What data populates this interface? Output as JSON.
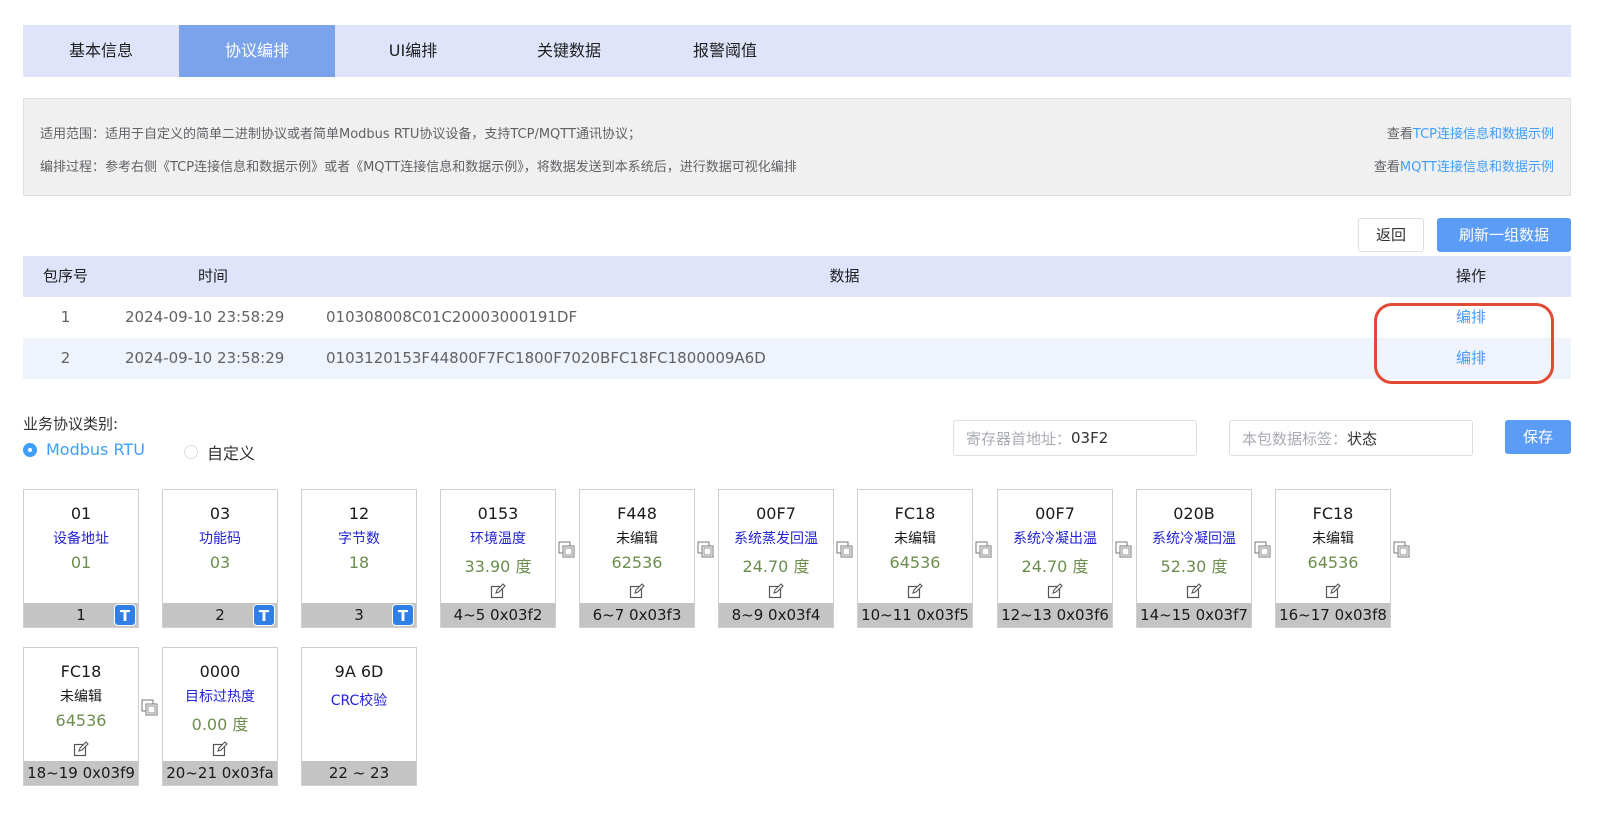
{
  "tabs": [
    "基本信息",
    "协议编排",
    "UI编排",
    "关键数据",
    "报警阈值"
  ],
  "active_tab": 1,
  "info": {
    "line1": "适用范围：适用于自定义的简单二进制协议或者简单Modbus RTU协议设备，支持TCP/MQTT通讯协议；",
    "line2": "编排过程：参考右侧《TCP连接信息和数据示例》或者《MQTT连接信息和数据示例》，将数据发送到本系统后，进行数据可视化编排",
    "view_prefix": "查看",
    "tcp_link": "TCP连接信息和数据示例",
    "mqtt_link": "MQTT连接信息和数据示例"
  },
  "buttons": {
    "back": "返回",
    "refresh": "刷新一组数据",
    "save": "保存"
  },
  "table": {
    "headers": [
      "包序号",
      "时间",
      "数据",
      "操作"
    ],
    "rows": [
      {
        "seq": "1",
        "time": "2024-09-10 23:58:29",
        "data": "010308008C01C20003000191DF",
        "action": "编排"
      },
      {
        "seq": "2",
        "time": "2024-09-10 23:58:29",
        "data": "0103120153F44800F7FC1800F7020BFC18FC1800009A6D",
        "action": "编排"
      }
    ]
  },
  "protocol": {
    "title": "业务协议类别:",
    "options": [
      "Modbus RTU",
      "自定义"
    ],
    "selected": "Modbus RTU",
    "register_label": "寄存器首地址：",
    "register_value": "03F2",
    "tag_label": "本包数据标签：",
    "tag_value": "状态"
  },
  "cells": [
    {
      "hex": "01",
      "name": "设备地址",
      "val": "01",
      "foot": "1",
      "badge": "T",
      "edited": true
    },
    {
      "hex": "03",
      "name": "功能码",
      "val": "03",
      "foot": "2",
      "badge": "T",
      "edited": true
    },
    {
      "hex": "12",
      "name": "字节数",
      "val": "18",
      "foot": "3",
      "badge": "T",
      "edited": true
    },
    {
      "hex": "0153",
      "name": "环境温度",
      "val": "33.90 度",
      "foot": "4~5 0x03f2",
      "edited": true
    },
    {
      "hex": "F448",
      "name": "未编辑",
      "val": "62536",
      "foot": "6~7 0x03f3",
      "edited": false
    },
    {
      "hex": "00F7",
      "name": "系统蒸发回温",
      "val": "24.70 度",
      "foot": "8~9 0x03f4",
      "edited": true
    },
    {
      "hex": "FC18",
      "name": "未编辑",
      "val": "64536",
      "foot": "10~11 0x03f5",
      "edited": false
    },
    {
      "hex": "00F7",
      "name": "系统冷凝出温",
      "val": "24.70 度",
      "foot": "12~13 0x03f6",
      "edited": true
    },
    {
      "hex": "020B",
      "name": "系统冷凝回温",
      "val": "52.30 度",
      "foot": "14~15 0x03f7",
      "edited": true
    },
    {
      "hex": "FC18",
      "name": "未编辑",
      "val": "64536",
      "foot": "16~17 0x03f8",
      "edited": false
    },
    {
      "hex": "FC18",
      "name": "未编辑",
      "val": "64536",
      "foot": "18~19 0x03f9",
      "edited": false
    },
    {
      "hex": "0000",
      "name": "目标过热度",
      "val": "0.00 度",
      "foot": "20~21 0x03fa",
      "edited": true
    },
    {
      "hex": "9A 6D",
      "name": "CRC校验",
      "val": "",
      "foot": "22 ~ 23",
      "edited": true
    }
  ]
}
